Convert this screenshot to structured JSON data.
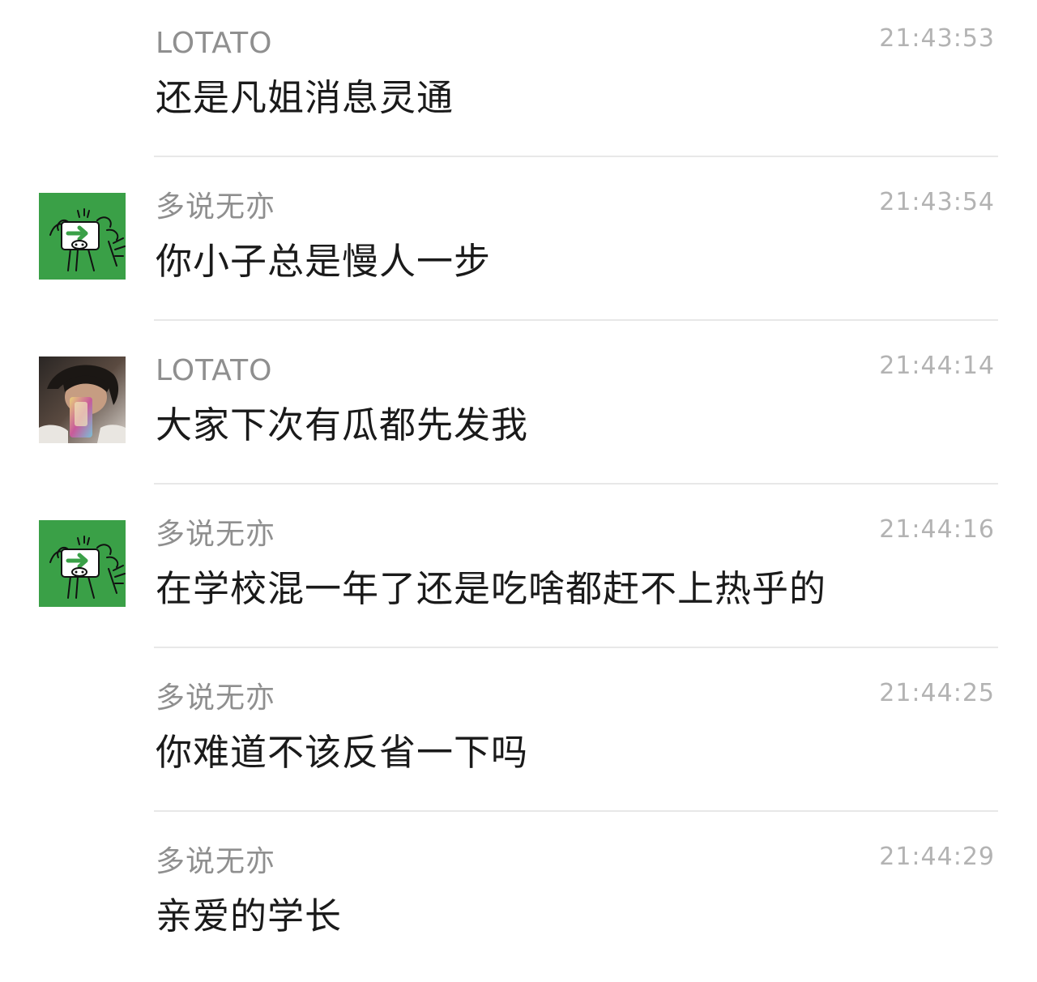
{
  "colors": {
    "background": "#ffffff",
    "sender_text": "#8f8f8f",
    "time_text": "#b3b3b3",
    "message_text": "#1a1a1a",
    "divider": "#e8e8e8",
    "avatar_green": "#3aa047"
  },
  "messages": [
    {
      "sender": "LOTATO",
      "time": "21:43:53",
      "text": "还是凡姐消息灵通",
      "avatar": null
    },
    {
      "sender": "多说无亦",
      "time": "21:43:54",
      "text": "你小子总是慢人一步",
      "avatar": "green-cartoon-avatar-icon"
    },
    {
      "sender": "LOTATO",
      "time": "21:44:14",
      "text": "大家下次有瓜都先发我",
      "avatar": "photo-avatar-icon"
    },
    {
      "sender": "多说无亦",
      "time": "21:44:16",
      "text": "在学校混一年了还是吃啥都赶不上热乎的",
      "avatar": "green-cartoon-avatar-icon"
    },
    {
      "sender": "多说无亦",
      "time": "21:44:25",
      "text": "你难道不该反省一下吗",
      "avatar": null
    },
    {
      "sender": "多说无亦",
      "time": "21:44:29",
      "text": "亲爱的学长",
      "avatar": null
    }
  ]
}
